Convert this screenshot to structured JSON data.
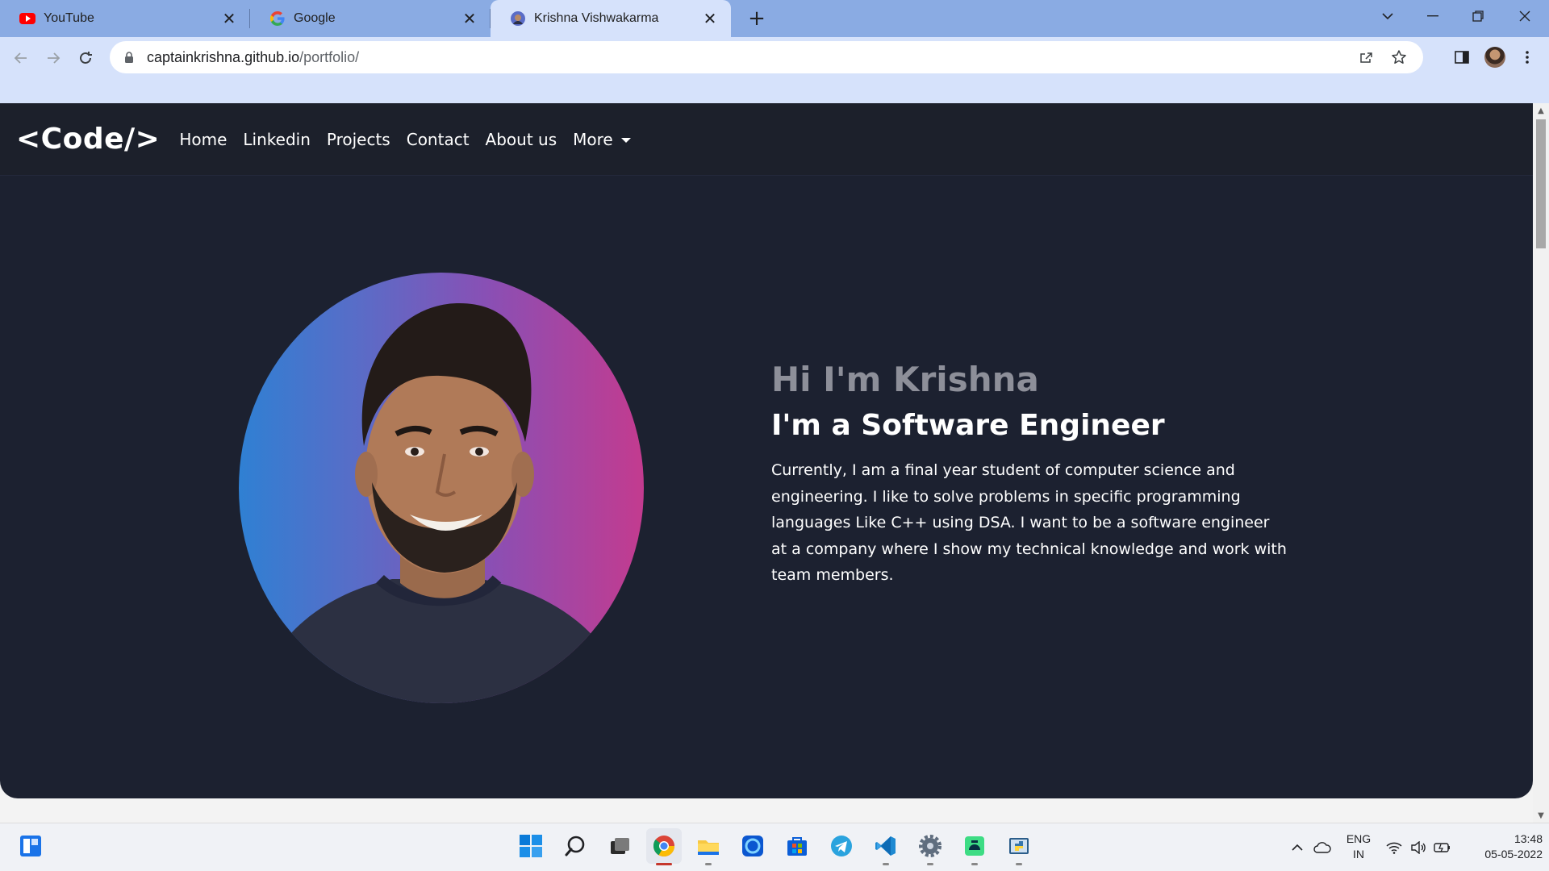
{
  "browser": {
    "tabs": [
      {
        "title": "YouTube",
        "favicon": "youtube-icon"
      },
      {
        "title": "Google",
        "favicon": "google-g-icon"
      },
      {
        "title": "Krishna Vishwakarma",
        "favicon": "profile-favicon"
      }
    ],
    "url_host": "captainkrishna.github.io",
    "url_path": "/portfolio/"
  },
  "site": {
    "brand": "<Code/>",
    "nav": [
      "Home",
      "Linkedin",
      "Projects",
      "Contact",
      "About us",
      "More"
    ],
    "hero": {
      "greeting": "Hi I'm Krishna",
      "title": "I'm a Software Engineer",
      "description": "Currently, I am a final year student of computer science and engineering. I like to solve problems in specific programming languages Like C++ using DSA. I want to be a software engineer at a company where I show my technical knowledge and work with team members."
    }
  },
  "taskbar": {
    "apps": [
      "start-icon",
      "search-icon",
      "task-view-icon",
      "chrome-icon",
      "file-explorer-icon",
      "edge-icon",
      "store-icon",
      "telegram-icon",
      "vscode-icon",
      "settings-icon",
      "android-studio-icon",
      "python-icon"
    ],
    "language": "ENG",
    "region": "IN",
    "time": "13:48",
    "date": "05-05-2022"
  },
  "colors": {
    "tabstrip": "#8aabe3",
    "toolbar": "#d6e2fb",
    "page_bg": "#1c2130",
    "greeting": "#8d8f99",
    "accent_red": "#c5372c"
  }
}
